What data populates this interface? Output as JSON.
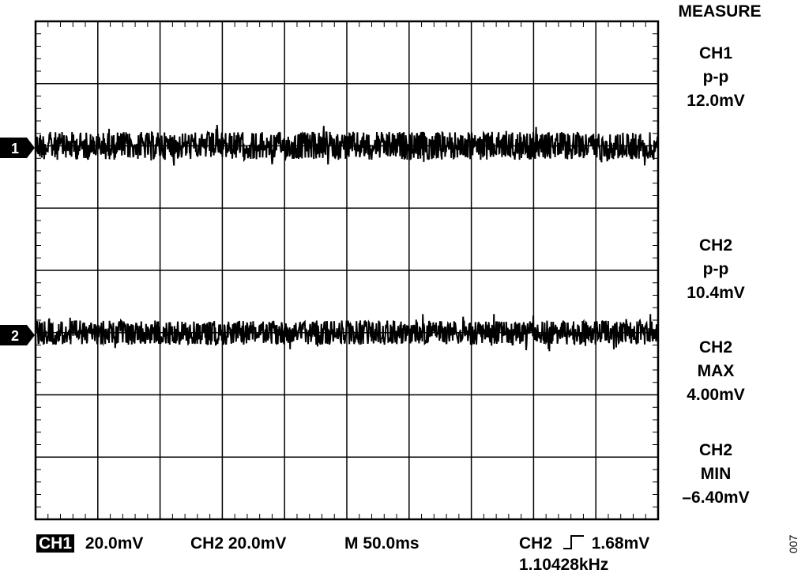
{
  "measure": {
    "heading": "MEASURE",
    "readouts": [
      {
        "channel": "CH1",
        "type": "p-p",
        "value": "12.0mV"
      },
      {
        "channel": "CH2",
        "type": "p-p",
        "value": "10.4mV"
      },
      {
        "channel": "CH2",
        "type": "MAX",
        "value": "4.00mV"
      },
      {
        "channel": "CH2",
        "type": "MIN",
        "value": "–6.40mV"
      }
    ]
  },
  "markers": {
    "ch1": "1",
    "ch2": "2"
  },
  "status": {
    "ch1_label": "CH1",
    "ch1_scale": "20.0mV",
    "ch2_scale": "CH2 20.0mV",
    "timebase": "M 50.0ms",
    "trigger_source": "CH2",
    "trigger_level": "1.68mV",
    "frequency": "1.10428kHz"
  },
  "figure_id": "007",
  "chart_data": {
    "type": "line",
    "grid": true,
    "divisions": {
      "x": 10,
      "y": 8
    },
    "series": [
      {
        "name": "1",
        "description_level_divisions_from_top": 2,
        "peak_to_peak_mV": 12.0,
        "volts_per_div_mV": 20.0
      },
      {
        "name": "2",
        "description_level_divisions_from_top": 5,
        "peak_to_peak_mV": 10.4,
        "max_mV": 4.0,
        "min_mV": -6.4,
        "volts_per_div_mV": 20.0
      }
    ],
    "colors": {
      "trace": "#000000",
      "grid": "#000000",
      "background": "#ffffff"
    }
  }
}
